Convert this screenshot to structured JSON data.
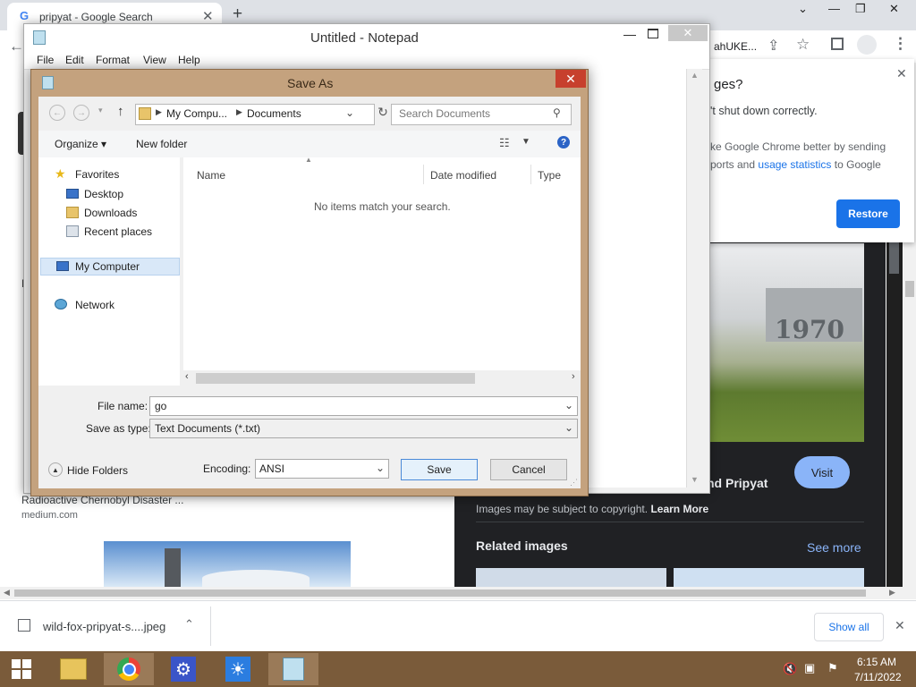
{
  "browser": {
    "tab_title": "pripyat - Google Search",
    "tab_favicon": "G",
    "url_fragment": "ahUKE...",
    "restore_popup": {
      "title": "ges?",
      "line1": "'t shut down correctly.",
      "line2": "ke Google Chrome better by sending",
      "line3_pre": "ports and",
      "line3_link": "usage statistics",
      "line3_post": "to Google",
      "restore_label": "Restore"
    },
    "page": {
      "heading_fragment": "nd Pripyat",
      "visit_label": "Visit",
      "copyright_note": "Images may be subject to copyright.",
      "learn_more": "Learn More",
      "related_images": "Related images",
      "see_more": "See more",
      "result_snippet": "Radioactive Chernobyl Disaster ...",
      "result_source": "medium.com",
      "left_l": "I",
      "sign_text": "1970"
    },
    "download": {
      "filename": "wild-fox-pripyat-s....jpeg",
      "show_all": "Show all"
    }
  },
  "notepad": {
    "title": "Untitled - Notepad",
    "menu": [
      "File",
      "Edit",
      "Format",
      "View",
      "Help"
    ]
  },
  "save_dialog": {
    "title": "Save As",
    "breadcrumb": [
      "My Compu...",
      "Documents"
    ],
    "search_placeholder": "Search Documents",
    "organize": "Organize",
    "new_folder": "New folder",
    "nav": {
      "favorites": "Favorites",
      "desktop": "Desktop",
      "downloads": "Downloads",
      "recent": "Recent places",
      "my_computer": "My Computer",
      "network": "Network"
    },
    "columns": [
      "Name",
      "Date modified",
      "Type"
    ],
    "empty_message": "No items match your search.",
    "file_name_label": "File name:",
    "file_name_value": "go",
    "save_type_label": "Save as type:",
    "save_type_value": "Text Documents (*.txt)",
    "encoding_label": "Encoding:",
    "encoding_value": "ANSI",
    "save": "Save",
    "cancel": "Cancel",
    "hide_folders": "Hide Folders"
  },
  "taskbar": {
    "time": "6:15 AM",
    "date": "7/11/2022"
  },
  "colors": {
    "dialog_frame": "#c4a27e",
    "taskbar": "#7a5b3a",
    "chrome_blue": "#1a73e8"
  }
}
